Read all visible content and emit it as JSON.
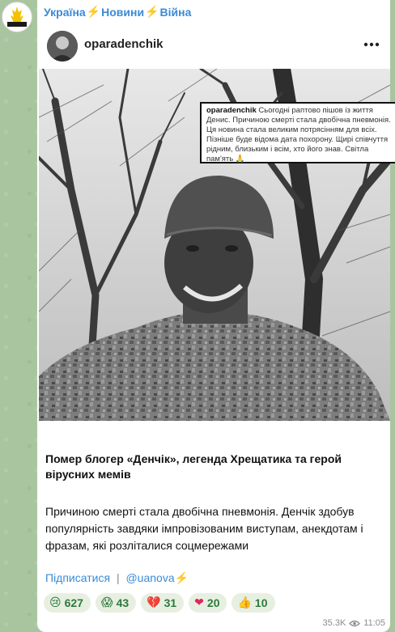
{
  "channel": {
    "name_parts": [
      "Україна",
      "Новини",
      "Війна"
    ],
    "bolt_glyph": "⚡",
    "logo_text": "УКРАЇНА НОВИНИ"
  },
  "post": {
    "username": "oparadenchik",
    "caption_username": "oparadenchik",
    "caption_text": "Сьогодні раптово пішов із життя Денис. Причиною смерті стала двобічна пневмонія. Ця новина стала великим потрясінням для всіх. Пізніше буде відома дата похорону. Щирі співчуття рідним, близьким і всім, хто його знав. Світла пам'ять 🙏",
    "title": "Помер блогер «Денчік», легенда Хрещатика та герой вірусних мемів",
    "body": "Причиною смерті стала двобічна пневмонія. Денчік здобув популярність завдяки імпровізованим виступам, анекдотам і фразам, які розліталися соцмережами",
    "subscribe_label": "Підписатися",
    "separator": "|",
    "channel_handle": "@uanova⚡"
  },
  "reactions": [
    {
      "emoji": "😢",
      "count": "627"
    },
    {
      "emoji": "😱",
      "count": "43"
    },
    {
      "emoji": "💔",
      "count": "31"
    },
    {
      "emoji": "❤",
      "count": "20"
    },
    {
      "emoji": "👍",
      "count": "10"
    }
  ],
  "meta": {
    "views": "35.3K",
    "time": "11:05"
  },
  "colors": {
    "link": "#3a8bd6",
    "reaction_bg": "#e7efe1",
    "reaction_text": "#2c7a3d",
    "bolt": "#f5b400"
  }
}
